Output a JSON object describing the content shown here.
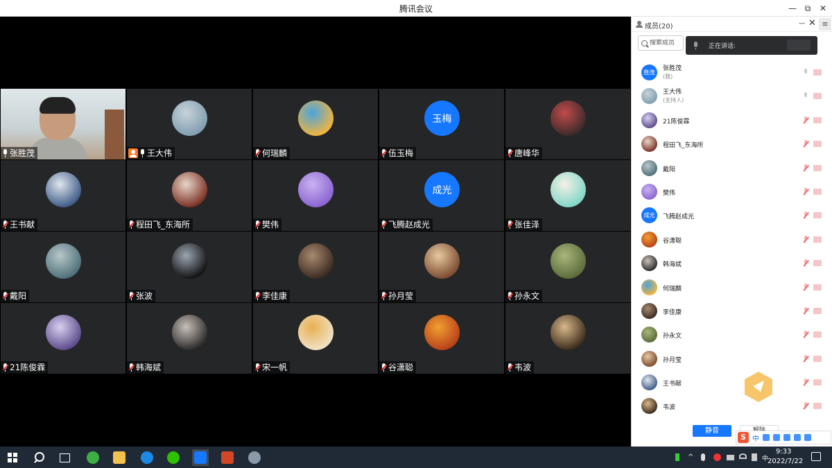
{
  "window": {
    "title": "腾讯会议",
    "minimize": "—",
    "maximize": "⧉",
    "close": "✕"
  },
  "grid": {
    "tiles": [
      {
        "name": "张胜茂",
        "kind": "video",
        "mic": "on"
      },
      {
        "name": "王大伟",
        "kind": "photo",
        "mic": "on",
        "host": true,
        "colors": [
          "#7f9db0",
          "#c7d3da"
        ]
      },
      {
        "name": "何瑞麟",
        "kind": "photo",
        "mic": "muted",
        "colors": [
          "#f4b53a",
          "#4aa3e0"
        ]
      },
      {
        "name": "伍玉梅",
        "kind": "text",
        "avatar_text": "玉梅",
        "mic": "muted"
      },
      {
        "name": "唐峰华",
        "kind": "photo",
        "mic": "muted",
        "colors": [
          "#3a2a2a",
          "#c24a4a"
        ]
      },
      {
        "name": "王书献",
        "kind": "photo",
        "mic": "muted",
        "colors": [
          "#3c5a86",
          "#e0e6ee"
        ]
      },
      {
        "name": "程田飞_东海所",
        "kind": "photo",
        "mic": "muted",
        "colors": [
          "#7a2e22",
          "#e7d6c8"
        ]
      },
      {
        "name": "樊伟",
        "kind": "photo",
        "mic": "muted",
        "colors": [
          "#8a63d2",
          "#c9b3f0"
        ]
      },
      {
        "name": "飞腾赵成光",
        "kind": "text",
        "avatar_text": "成光",
        "mic": "muted"
      },
      {
        "name": "张佳泽",
        "kind": "photo",
        "mic": "muted",
        "colors": [
          "#7fd6c8",
          "#f5f0e6"
        ]
      },
      {
        "name": "戴阳",
        "kind": "photo",
        "mic": "muted",
        "colors": [
          "#4d6f78",
          "#b8c7c9"
        ]
      },
      {
        "name": "张波",
        "kind": "photo",
        "mic": "muted",
        "colors": [
          "#111111",
          "#9aa5b0"
        ]
      },
      {
        "name": "李佳康",
        "kind": "photo",
        "mic": "muted",
        "colors": [
          "#3b2a20",
          "#a88a70"
        ]
      },
      {
        "name": "孙月莹",
        "kind": "photo",
        "mic": "muted",
        "colors": [
          "#7a4a30",
          "#e8c9a0"
        ]
      },
      {
        "name": "孙永文",
        "kind": "photo",
        "mic": "muted",
        "colors": [
          "#5a6a3a",
          "#a9b77a"
        ]
      },
      {
        "name": "21陈俊霖",
        "kind": "photo",
        "mic": "muted",
        "colors": [
          "#5a4a8a",
          "#d8d0f0"
        ]
      },
      {
        "name": "韩海斌",
        "kind": "photo",
        "mic": "muted",
        "colors": [
          "#2a2a2a",
          "#c9c0b8"
        ]
      },
      {
        "name": "宋一帆",
        "kind": "photo",
        "mic": "muted",
        "colors": [
          "#f0e2c8",
          "#e8b050"
        ]
      },
      {
        "name": "谷潇聪",
        "kind": "photo",
        "mic": "muted",
        "colors": [
          "#b8401a",
          "#f0a030"
        ]
      },
      {
        "name": "韦波",
        "kind": "photo",
        "mic": "muted",
        "colors": [
          "#3a2a1a",
          "#d8b88a"
        ]
      }
    ]
  },
  "panel": {
    "title": "成员(20)",
    "more": "···",
    "close": "✕",
    "menu": "≡",
    "search_placeholder": "搜索成员",
    "speaking_label": "正在讲话:",
    "members": [
      {
        "name": "张胜茂",
        "role": "(我)",
        "kind": "text",
        "avatar_text": "胜茂",
        "mic": "on"
      },
      {
        "name": "王大伟",
        "role": "(主持人)",
        "kind": "photo",
        "colors": [
          "#7f9db0",
          "#c7d3da"
        ],
        "mic": "on"
      },
      {
        "name": "21陈俊霖",
        "role": "",
        "kind": "photo",
        "colors": [
          "#5a4a8a",
          "#d8d0f0"
        ],
        "mic": "muted"
      },
      {
        "name": "程田飞_东海所",
        "role": "",
        "kind": "photo",
        "colors": [
          "#7a2e22",
          "#e7d6c8"
        ],
        "mic": "muted"
      },
      {
        "name": "戴阳",
        "role": "",
        "kind": "photo",
        "colors": [
          "#4d6f78",
          "#b8c7c9"
        ],
        "mic": "muted"
      },
      {
        "name": "樊伟",
        "role": "",
        "kind": "photo",
        "colors": [
          "#8a63d2",
          "#c9b3f0"
        ],
        "mic": "muted"
      },
      {
        "name": "飞腾赵成光",
        "role": "",
        "kind": "text",
        "avatar_text": "成光",
        "mic": "muted"
      },
      {
        "name": "谷潇聪",
        "role": "",
        "kind": "photo",
        "colors": [
          "#b8401a",
          "#f0a030"
        ],
        "mic": "muted"
      },
      {
        "name": "韩海斌",
        "role": "",
        "kind": "photo",
        "colors": [
          "#2a2a2a",
          "#c9c0b8"
        ],
        "mic": "muted"
      },
      {
        "name": "何瑞麟",
        "role": "",
        "kind": "photo",
        "colors": [
          "#f4b53a",
          "#4aa3e0"
        ],
        "mic": "muted"
      },
      {
        "name": "李佳康",
        "role": "",
        "kind": "photo",
        "colors": [
          "#3b2a20",
          "#a88a70"
        ],
        "mic": "muted"
      },
      {
        "name": "孙永文",
        "role": "",
        "kind": "photo",
        "colors": [
          "#5a6a3a",
          "#a9b77a"
        ],
        "mic": "muted"
      },
      {
        "name": "孙月莹",
        "role": "",
        "kind": "photo",
        "colors": [
          "#7a4a30",
          "#e8c9a0"
        ],
        "mic": "muted"
      },
      {
        "name": "王书献",
        "role": "",
        "kind": "photo",
        "colors": [
          "#3c5a86",
          "#e0e6ee"
        ],
        "mic": "muted"
      },
      {
        "name": "韦波",
        "role": "",
        "kind": "photo",
        "colors": [
          "#3a2a1a",
          "#d8b88a"
        ],
        "mic": "muted"
      }
    ],
    "mute_all": "静音",
    "unmute_all": "解除"
  },
  "ime": {
    "logo": "S",
    "mode": "中"
  },
  "taskbar": {
    "time": "9:33",
    "date": "2022/7/22",
    "apps": [
      {
        "icon": "browser-360-icon",
        "color": "#3cb043"
      },
      {
        "icon": "file-explorer-icon",
        "color": "#f2c14e"
      },
      {
        "icon": "edge-icon",
        "color": "#1e88e5"
      },
      {
        "icon": "wechat-icon",
        "color": "#2dc100"
      },
      {
        "icon": "tencent-meeting-icon",
        "color": "#1677ff"
      },
      {
        "icon": "powerpoint-icon",
        "color": "#d24726"
      },
      {
        "icon": "paint-icon",
        "color": "#8a9aa8"
      }
    ]
  },
  "colors": {
    "accent": "#1677ff",
    "tile_bg": "#252628",
    "taskbar_bg": "#1f2a36",
    "muted_red": "#e33333"
  }
}
